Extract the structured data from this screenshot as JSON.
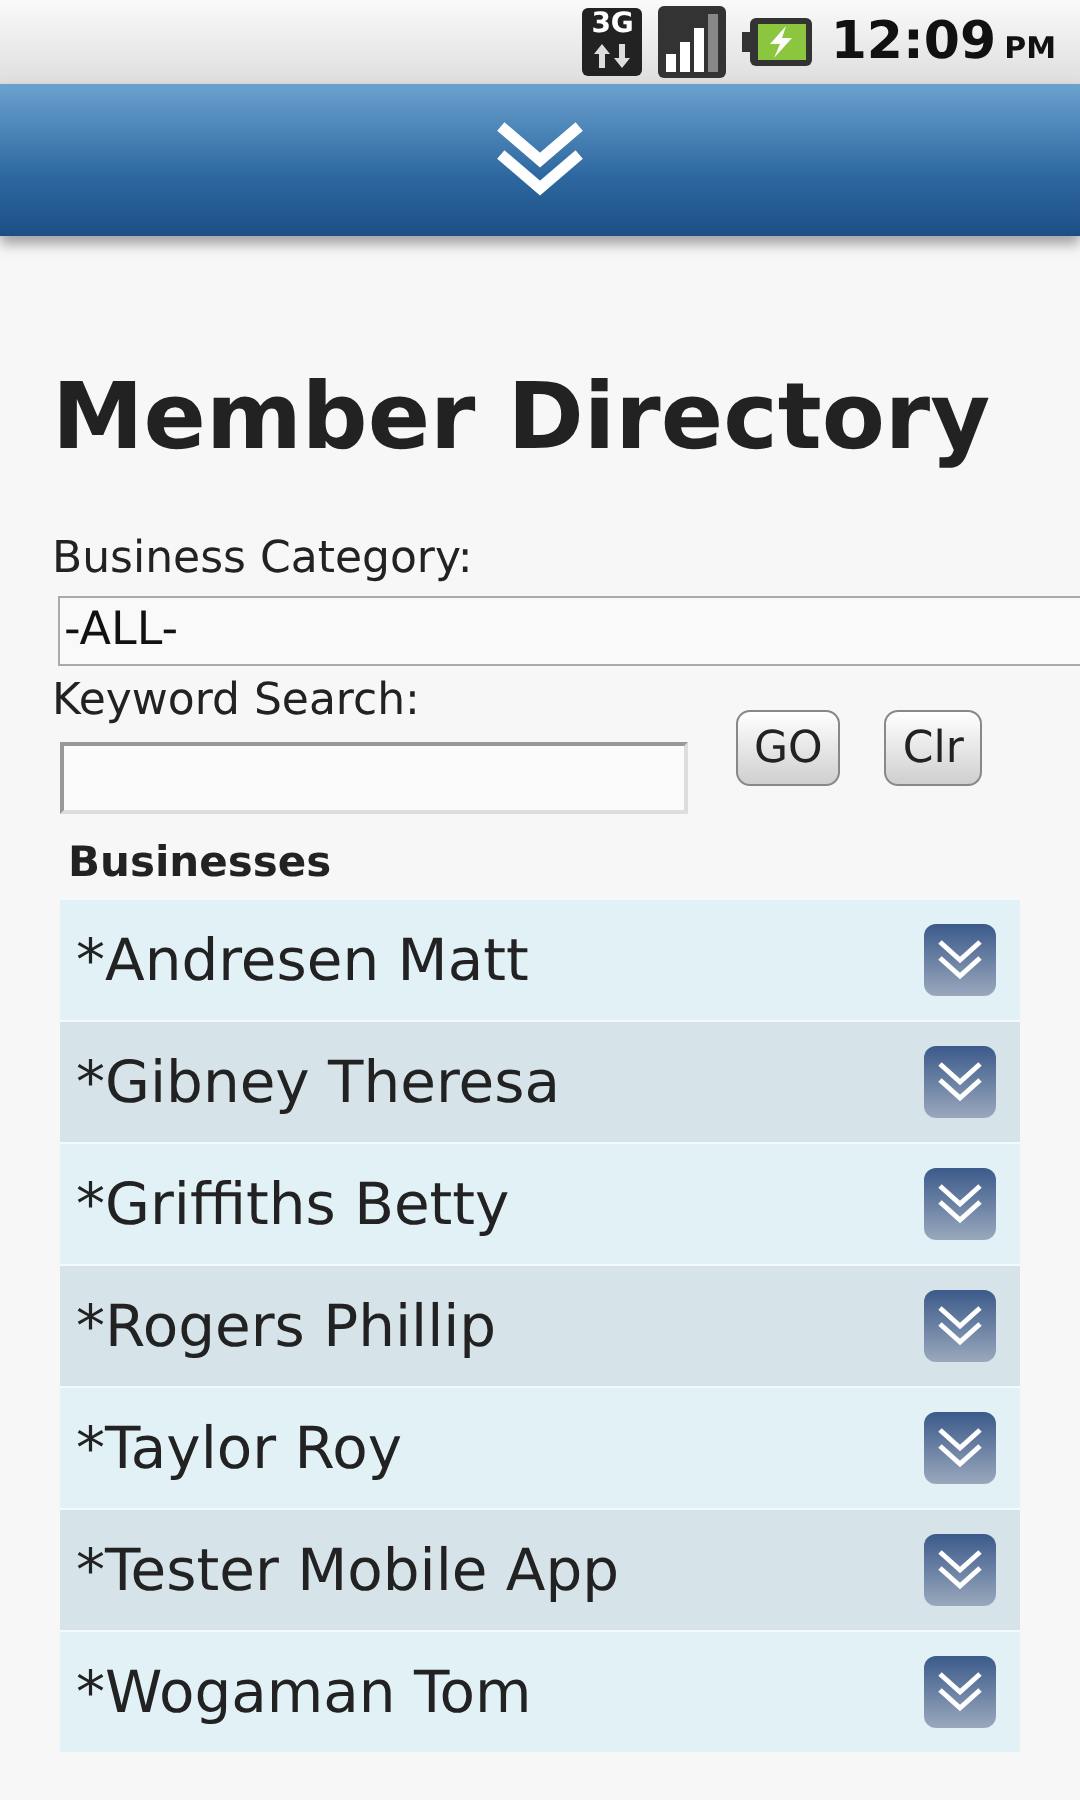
{
  "status_bar": {
    "network_type": "3G",
    "time": "12:09",
    "time_suffix": "PM"
  },
  "title": "Member Directory",
  "category": {
    "label": "Business Category:",
    "value": "-ALL-"
  },
  "keyword": {
    "label": "Keyword Search:"
  },
  "buttons": [
    "GO",
    "Clr"
  ],
  "section_title": "Businesses",
  "businesses": [
    {
      "name": "*Andresen Matt"
    },
    {
      "name": "*Gibney Theresa"
    },
    {
      "name": "*Griffiths Betty"
    },
    {
      "name": "*Rogers Phillip"
    },
    {
      "name": "*Taylor Roy"
    },
    {
      "name": "*Tester Mobile App"
    },
    {
      "name": "*Wogaman Tom"
    }
  ]
}
